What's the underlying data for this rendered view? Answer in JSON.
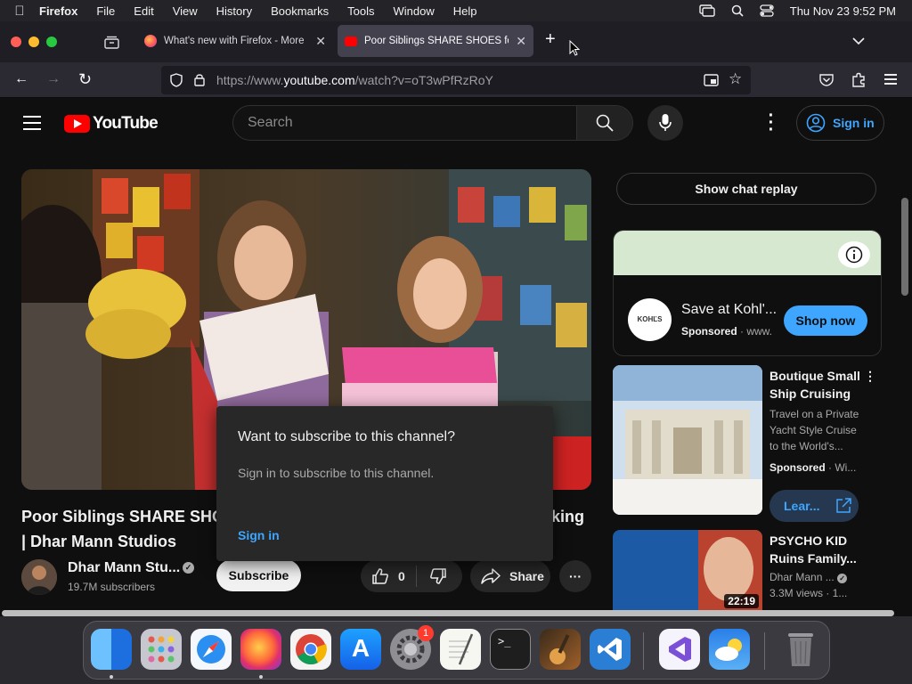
{
  "menubar": {
    "app": "Firefox",
    "items": [
      "File",
      "Edit",
      "View",
      "History",
      "Bookmarks",
      "Tools",
      "Window",
      "Help"
    ],
    "clock": "Thu Nov 23  9:52 PM"
  },
  "tabs": [
    {
      "title": "What's new with Firefox - More"
    },
    {
      "title": "Poor Siblings SHARE SHOES for"
    }
  ],
  "urlbar": {
    "prefix": "https://www.",
    "domain": "youtube.com",
    "path": "/watch?v=oT3wPfRzRoY"
  },
  "youtube": {
    "logo_text": "YouTube",
    "search_placeholder": "Search",
    "sign_in": "Sign in"
  },
  "video": {
    "title_line1a": "Poor Siblings SHARE SHO",
    "title_line1b": "king",
    "title_line2": "| Dhar Mann Studios",
    "channel": "Dhar Mann Stu...",
    "subscribers": "19.7M subscribers",
    "subscribe_label": "Subscribe",
    "likes": "0",
    "share_label": "Share"
  },
  "popup": {
    "heading": "Want to subscribe to this channel?",
    "body": "Sign in to subscribe to this channel.",
    "action": "Sign in"
  },
  "sidebar": {
    "chat_replay": "Show chat replay",
    "ad": {
      "logo_text": "KOHĽS",
      "title": "Save at Kohl'...",
      "sponsored": "Sponsored",
      "site": " · www.",
      "cta": "Shop now"
    },
    "cards": [
      {
        "title": "Boutique Small Ship Cruising",
        "description": "Travel on a Private Yacht Style Cruise to the World's...",
        "sponsored": "Sponsored",
        "extra": " · Wi...",
        "cta": "Lear..."
      },
      {
        "title": "PSYCHO KID Ruins Family...",
        "channel": "Dhar Mann ...",
        "views": "3.3M views · 1...",
        "duration": "22:19"
      }
    ]
  },
  "dock": {
    "settings_badge": "1"
  },
  "colors": {
    "yt_red": "#ff0000",
    "link_blue": "#3ea6ff",
    "page_bg": "#0f0f0f"
  }
}
